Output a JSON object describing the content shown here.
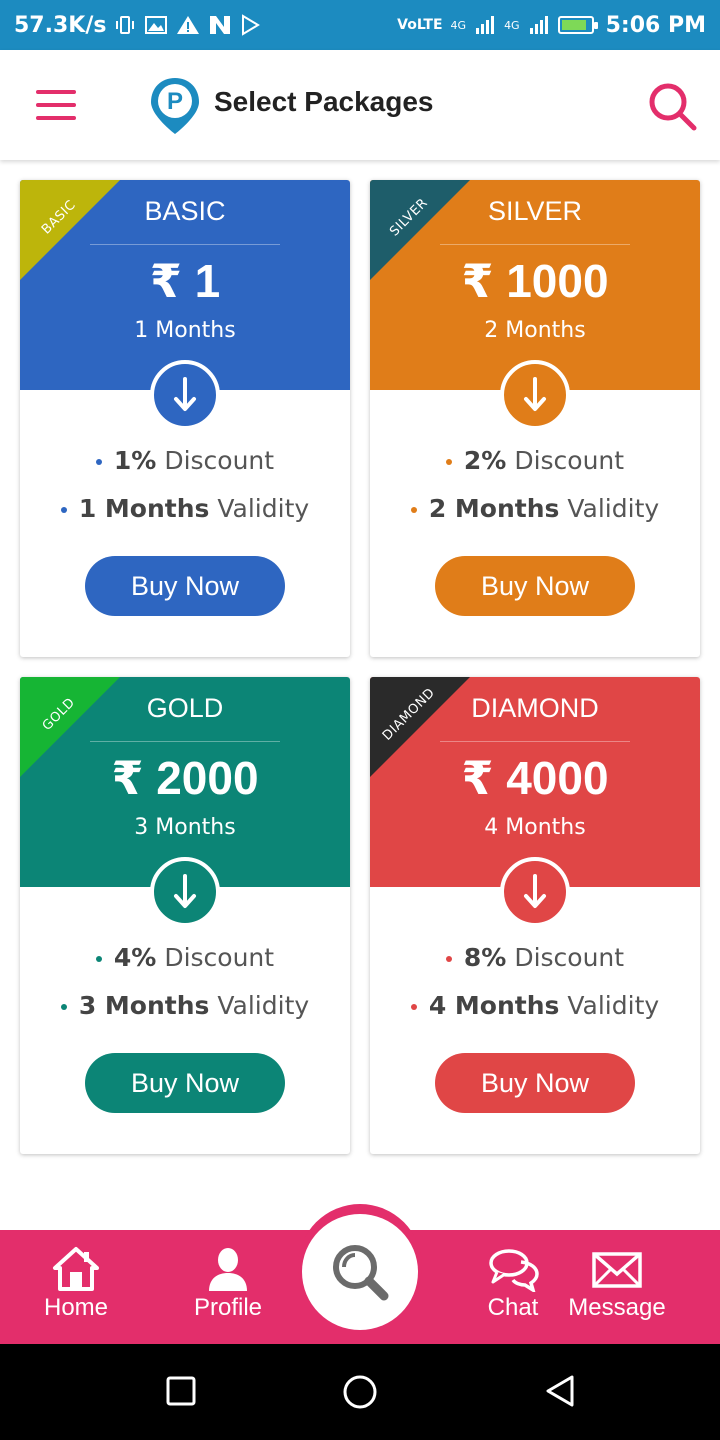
{
  "status_bar": {
    "speed": "57.3K/s",
    "time": "5:06 PM",
    "icons": [
      "vibrate-icon",
      "gallery-icon",
      "alert-icon",
      "n-icon",
      "play-icon",
      "volte-icon",
      "signal-icon",
      "signal-icon",
      "battery-icon"
    ],
    "volte_label": "VoLTE",
    "net1": "4G",
    "net2": "4G"
  },
  "header": {
    "title": "Select Packages",
    "logo_letter": "P",
    "accent": "#e32e6b"
  },
  "packages": [
    {
      "ribbon": "BASIC",
      "name": "BASIC",
      "price": "₹ 1",
      "months": "1 Months",
      "discount_value": "1%",
      "discount_label": "Discount",
      "validity_value": "1 Months",
      "validity_label": "Validity",
      "button": "Buy Now",
      "color": "#2e66c1",
      "ribbon_color": "#bdb50b"
    },
    {
      "ribbon": "SILVER",
      "name": "SILVER",
      "price": "₹ 1000",
      "months": "2 Months",
      "discount_value": "2%",
      "discount_label": "Discount",
      "validity_value": "2 Months",
      "validity_label": "Validity",
      "button": "Buy Now",
      "color": "#e07d19",
      "ribbon_color": "#1e5d6a"
    },
    {
      "ribbon": "GOLD",
      "name": "GOLD",
      "price": "₹ 2000",
      "months": "3 Months",
      "discount_value": "4%",
      "discount_label": "Discount",
      "validity_value": "3 Months",
      "validity_label": "Validity",
      "button": "Buy Now",
      "color": "#0c8576",
      "ribbon_color": "#16b534"
    },
    {
      "ribbon": "DIAMOND",
      "name": "DIAMOND",
      "price": "₹ 4000",
      "months": "4 Months",
      "discount_value": "8%",
      "discount_label": "Discount",
      "validity_value": "4 Months",
      "validity_label": "Validity",
      "button": "Buy Now",
      "color": "#e04646",
      "ribbon_color": "#2a2a2a"
    }
  ],
  "bottom_nav": {
    "home": "Home",
    "profile": "Profile",
    "chat": "Chat",
    "message": "Message",
    "color": "#e32e6b"
  }
}
